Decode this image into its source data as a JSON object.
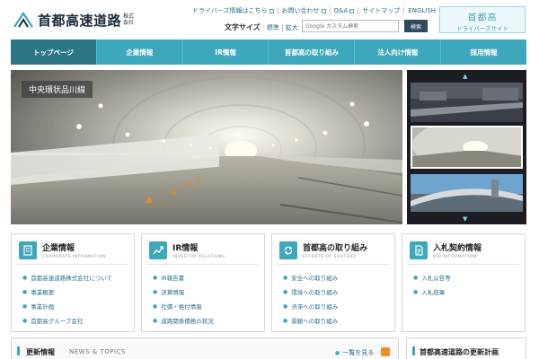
{
  "logo": {
    "name": "首都高速道路",
    "kabushiki": "株式会社"
  },
  "util_links": [
    {
      "label": "ドライバーズ情報はこちら",
      "external": true
    },
    {
      "label": "お問い合わせ",
      "external": true
    },
    {
      "label": "Q&A",
      "external": true
    },
    {
      "label": "サイトマップ",
      "external": false
    },
    {
      "label": "ENGLISH",
      "external": false
    }
  ],
  "font_size": {
    "label": "文字サイズ",
    "standard": "標準",
    "large": "拡大"
  },
  "search": {
    "placeholder": "Google カスタム検索",
    "button": "検索"
  },
  "driver_site": {
    "line1": "首都高",
    "line2": "ドライバーズサイト"
  },
  "nav": [
    {
      "label": "トップページ",
      "active": true
    },
    {
      "label": "企業情報",
      "active": false
    },
    {
      "label": "IR情報",
      "active": false
    },
    {
      "label": "首都高の取り組み",
      "active": false
    },
    {
      "label": "法人向け情報",
      "active": false
    },
    {
      "label": "採用情報",
      "active": false
    }
  ],
  "hero": {
    "caption": "中央環状品川線"
  },
  "cards": [
    {
      "icon": "building-icon",
      "title": "企業情報",
      "subtitle": "CORPORATE INFORMATION",
      "links": [
        "首都高速道路株式会社について",
        "事業概要",
        "事業計画",
        "首都高グループ会社"
      ]
    },
    {
      "icon": "chart-up-icon",
      "title": "IR情報",
      "subtitle": "INVESTOR RELATIONS",
      "links": [
        "IR報告書",
        "決算情報",
        "社債・格付情報",
        "道路関係債務の状況"
      ]
    },
    {
      "icon": "cycle-icon",
      "title": "首都高の取り組み",
      "subtitle": "EFFORTS OF SHUTOKO",
      "links": [
        "安全への取り組み",
        "環境への取り組み",
        "渋滞への取り組み",
        "景観への取り組み"
      ]
    },
    {
      "icon": "document-icon",
      "title": "入札契約情報",
      "subtitle": "BID INFORMATION",
      "links": [
        "入札公告等",
        "入札結果"
      ]
    }
  ],
  "news": {
    "title": "更新情報",
    "subtitle": "NEWS & TOPICS",
    "more": "一覧を見る"
  },
  "update_plan": {
    "title": "首都高速道路の更新計画"
  },
  "colors": {
    "accent": "#3da8bb",
    "nav_active": "#2b7787",
    "link": "#2a6f8f"
  }
}
